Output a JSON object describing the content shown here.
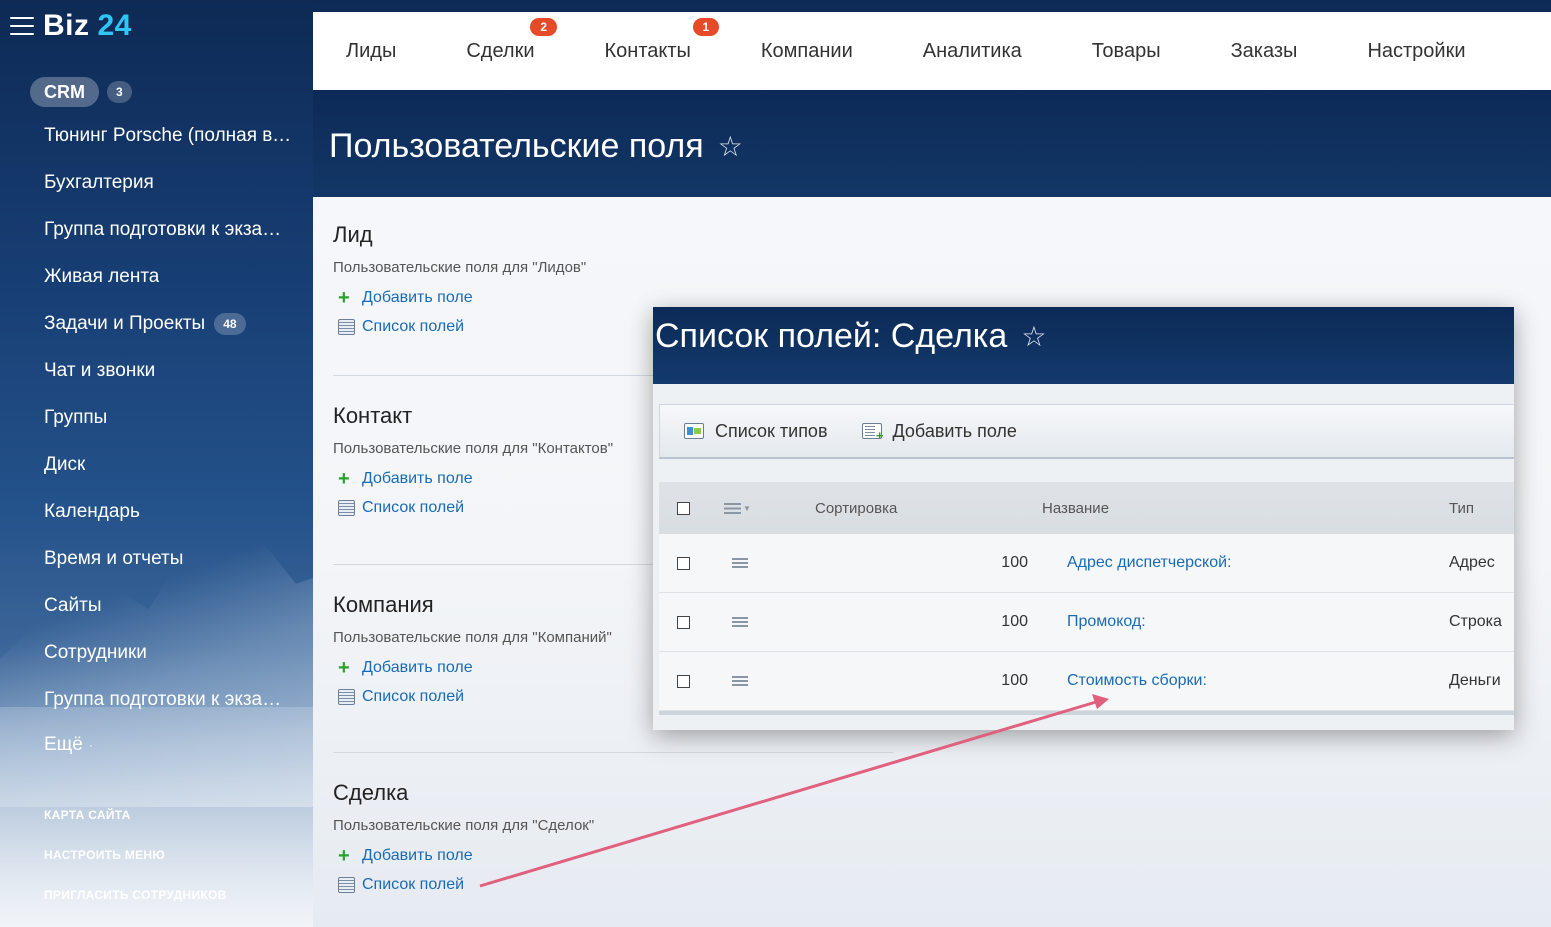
{
  "app": {
    "logo_text": "Biz",
    "logo_num": "24"
  },
  "sidebar": {
    "crm_label": "CRM",
    "crm_count": "3",
    "items": [
      {
        "label": "Тюнинг Porsche (полная версия)",
        "badge": ""
      },
      {
        "label": "Бухгалтерия",
        "badge": ""
      },
      {
        "label": "Группа подготовки к экзамену",
        "badge": ""
      },
      {
        "label": "Живая лента",
        "badge": ""
      },
      {
        "label": "Задачи и Проекты",
        "badge": "48"
      },
      {
        "label": "Чат и звонки",
        "badge": ""
      },
      {
        "label": "Группы",
        "badge": ""
      },
      {
        "label": "Диск",
        "badge": ""
      },
      {
        "label": "Календарь",
        "badge": ""
      },
      {
        "label": "Время и отчеты",
        "badge": ""
      },
      {
        "label": "Сайты",
        "badge": ""
      },
      {
        "label": "Сотрудники",
        "badge": ""
      },
      {
        "label": "Группа подготовки к экзамену",
        "badge": ""
      }
    ],
    "more_label": "Ещё",
    "bottom_links": [
      "КАРТА САЙТА",
      "НАСТРОИТЬ МЕНЮ",
      "ПРИГЛАСИТЬ СОТРУДНИКОВ"
    ]
  },
  "topnav": {
    "tabs": [
      {
        "label": "Лиды",
        "badge": ""
      },
      {
        "label": "Сделки",
        "badge": "2"
      },
      {
        "label": "Контакты",
        "badge": "1"
      },
      {
        "label": "Компании",
        "badge": ""
      },
      {
        "label": "Аналитика",
        "badge": ""
      },
      {
        "label": "Товары",
        "badge": ""
      },
      {
        "label": "Заказы",
        "badge": ""
      },
      {
        "label": "Настройки",
        "badge": ""
      }
    ]
  },
  "page": {
    "title": "Пользовательские поля"
  },
  "sections": [
    {
      "title": "Лид",
      "subtitle": "Пользовательские поля для \"Лидов\"",
      "add_label": "Добавить поле",
      "list_label": "Список полей"
    },
    {
      "title": "Контакт",
      "subtitle": "Пользовательские поля для \"Контактов\"",
      "add_label": "Добавить поле",
      "list_label": "Список полей"
    },
    {
      "title": "Компания",
      "subtitle": "Пользовательские поля для \"Компаний\"",
      "add_label": "Добавить поле",
      "list_label": "Список полей"
    },
    {
      "title": "Сделка",
      "subtitle": "Пользовательские поля для \"Сделок\"",
      "add_label": "Добавить поле",
      "list_label": "Список полей"
    }
  ],
  "overlay": {
    "title": "Список полей: Сделка",
    "toolbar": {
      "types_label": "Список типов",
      "add_label": "Добавить поле"
    },
    "columns": {
      "sort": "Сортировка",
      "name": "Название",
      "type": "Тип"
    },
    "rows": [
      {
        "sort": "100",
        "name": "Адрес диспетчерской:",
        "type": "Адрес"
      },
      {
        "sort": "100",
        "name": "Промокод:",
        "type": "Строка"
      },
      {
        "sort": "100",
        "name": "Стоимость сборки:",
        "type": "Деньги"
      }
    ]
  },
  "colors": {
    "accent_link": "#1a6bb5",
    "badge_red": "#e64a28",
    "logo_accent": "#2fc6f6",
    "annotation_arrow": "#e0607e"
  }
}
